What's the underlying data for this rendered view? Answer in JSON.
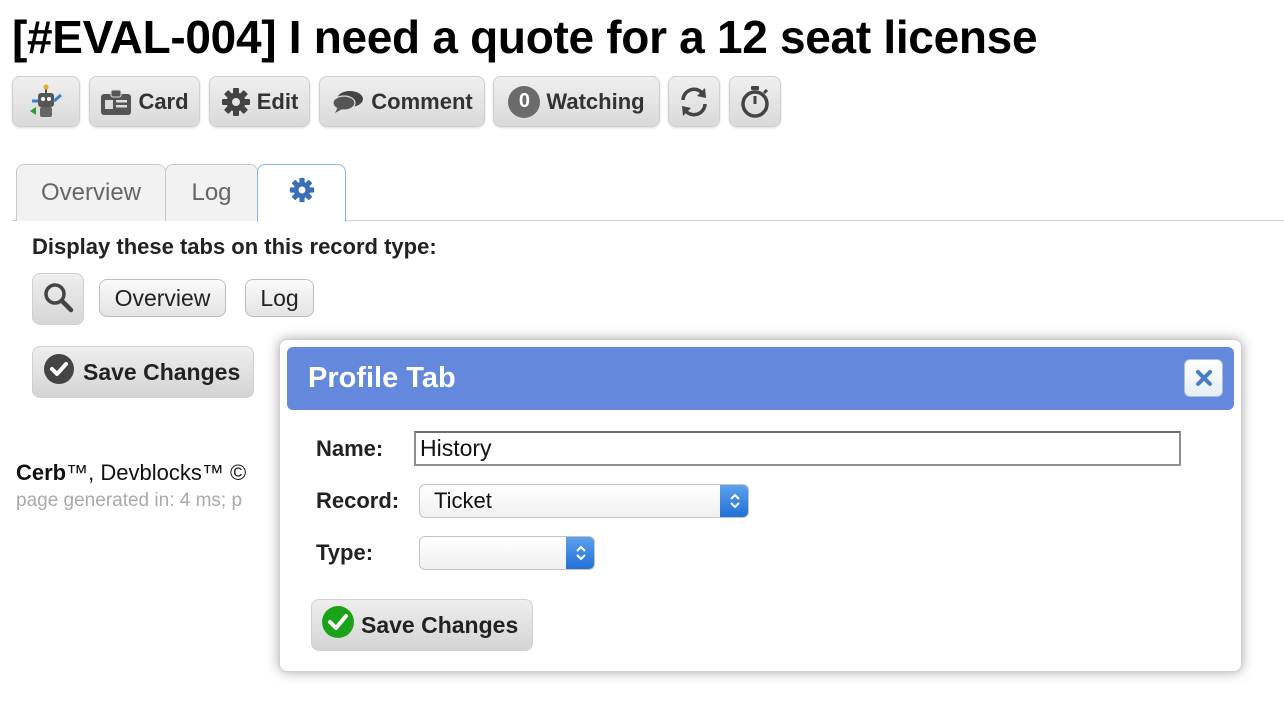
{
  "page": {
    "title": "[#EVAL-004] I need a quote for a 12 seat license"
  },
  "toolbar": {
    "card_label": "Card",
    "edit_label": "Edit",
    "comment_label": "Comment",
    "watch_count": "0",
    "watching_label": "Watching",
    "icons": [
      "bot-icon",
      "card-icon",
      "gear-icon",
      "comment-icon",
      "refresh-icon",
      "stopwatch-icon"
    ]
  },
  "tabs": [
    {
      "label": "Overview"
    },
    {
      "label": "Log"
    },
    {
      "label": "",
      "icon": "gear-icon",
      "active": true
    }
  ],
  "settings": {
    "prompt": "Display these tabs on this record type:",
    "chips": [
      "Overview",
      "Log"
    ],
    "save_label": "Save Changes"
  },
  "footer": {
    "brand": "Cerb",
    "rest": "™, Devblocks™ © ",
    "sub": "page generated in: 4 ms; p"
  },
  "dialog": {
    "title": "Profile Tab",
    "name_label": "Name:",
    "name_value": "History",
    "record_label": "Record:",
    "record_value": "Ticket",
    "type_label": "Type:",
    "type_value": "",
    "save_label": "Save Changes"
  },
  "colors": {
    "dialog_header": "#6388dc",
    "select_arrow": "#2f7fe0",
    "check_green": "#1aa31a",
    "tab_active_border": "#8ab4e8"
  }
}
